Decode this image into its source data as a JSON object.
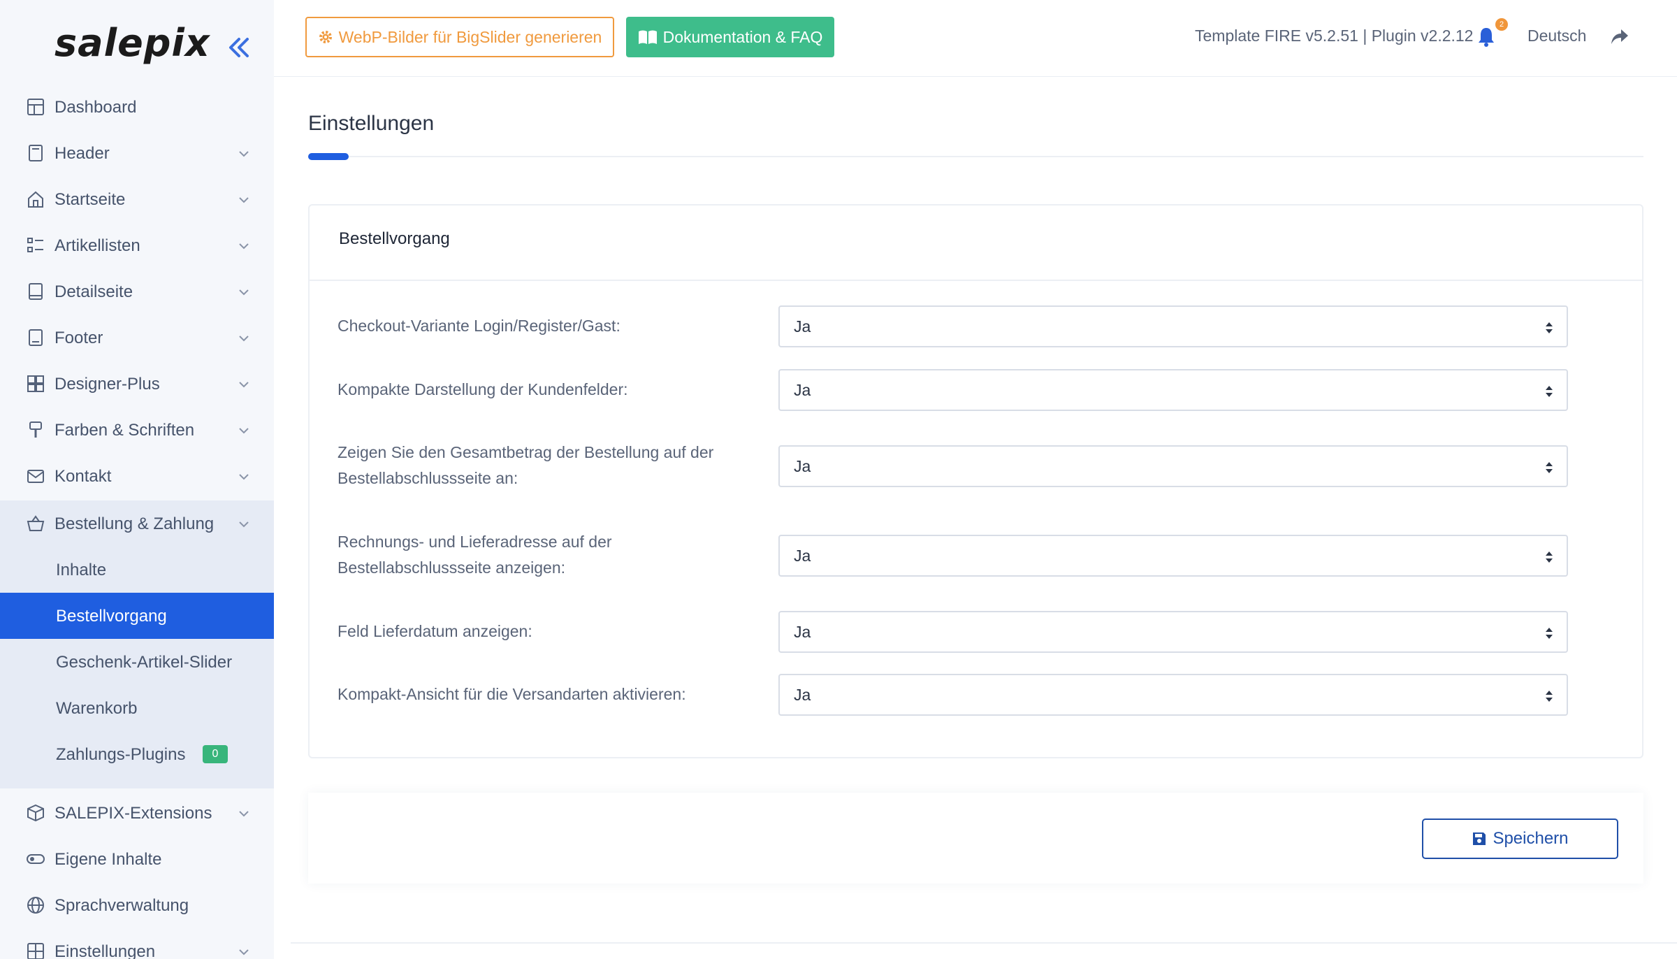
{
  "brand": {
    "logo": "salepix"
  },
  "topbar": {
    "webp_button": "WebP-Bilder für BigSlider generieren",
    "doc_button": "Dokumentation & FAQ",
    "version": "Template FIRE v5.2.51 | Plugin v2.2.12",
    "notifications": "2",
    "language": "Deutsch"
  },
  "sidebar": {
    "items": [
      {
        "label": "Dashboard",
        "icon": "dashboard-icon"
      },
      {
        "label": "Header",
        "icon": "header-icon"
      },
      {
        "label": "Startseite",
        "icon": "home-icon"
      },
      {
        "label": "Artikellisten",
        "icon": "list-icon"
      },
      {
        "label": "Detailseite",
        "icon": "book-icon"
      },
      {
        "label": "Footer",
        "icon": "footer-icon"
      },
      {
        "label": "Designer-Plus",
        "icon": "grid-icon"
      },
      {
        "label": "Farben & Schriften",
        "icon": "brush-icon"
      },
      {
        "label": "Kontakt",
        "icon": "mail-icon"
      },
      {
        "label": "Bestellung & Zahlung",
        "icon": "basket-icon"
      },
      {
        "label": "SALEPIX-Extensions",
        "icon": "box-icon"
      },
      {
        "label": "Eigene Inhalte",
        "icon": "toggle-icon"
      },
      {
        "label": "Sprachverwaltung",
        "icon": "globe-icon"
      },
      {
        "label": "Einstellungen",
        "icon": "settings-grid-icon"
      }
    ],
    "submenu": [
      {
        "label": "Inhalte"
      },
      {
        "label": "Bestellvorgang",
        "active": true
      },
      {
        "label": "Geschenk-Artikel-Slider"
      },
      {
        "label": "Warenkorb"
      },
      {
        "label": "Zahlungs-Plugins",
        "badge": "0"
      }
    ]
  },
  "main": {
    "title": "Einstellungen",
    "card_title": "Bestellvorgang",
    "rows": [
      {
        "label": "Checkout-Variante Login/Register/Gast:",
        "value": "Ja"
      },
      {
        "label": "Kompakte Darstellung der Kundenfelder:",
        "value": "Ja"
      },
      {
        "label": "Zeigen Sie den Gesamtbetrag der Bestellung auf der Bestellabschlussseite an:",
        "value": "Ja"
      },
      {
        "label": "Rechnungs- und Lieferadresse auf der Bestellabschlussseite anzeigen:",
        "value": "Ja"
      },
      {
        "label": "Feld Lieferdatum anzeigen:",
        "value": "Ja"
      },
      {
        "label": "Kompakt-Ansicht für die Versandarten aktivieren:",
        "value": "Ja"
      }
    ],
    "save_label": "Speichern"
  },
  "colors": {
    "accent": "#1f5ee0",
    "warning": "#f09a3e",
    "success": "#3ebd8b",
    "save": "#1f4fa8"
  }
}
